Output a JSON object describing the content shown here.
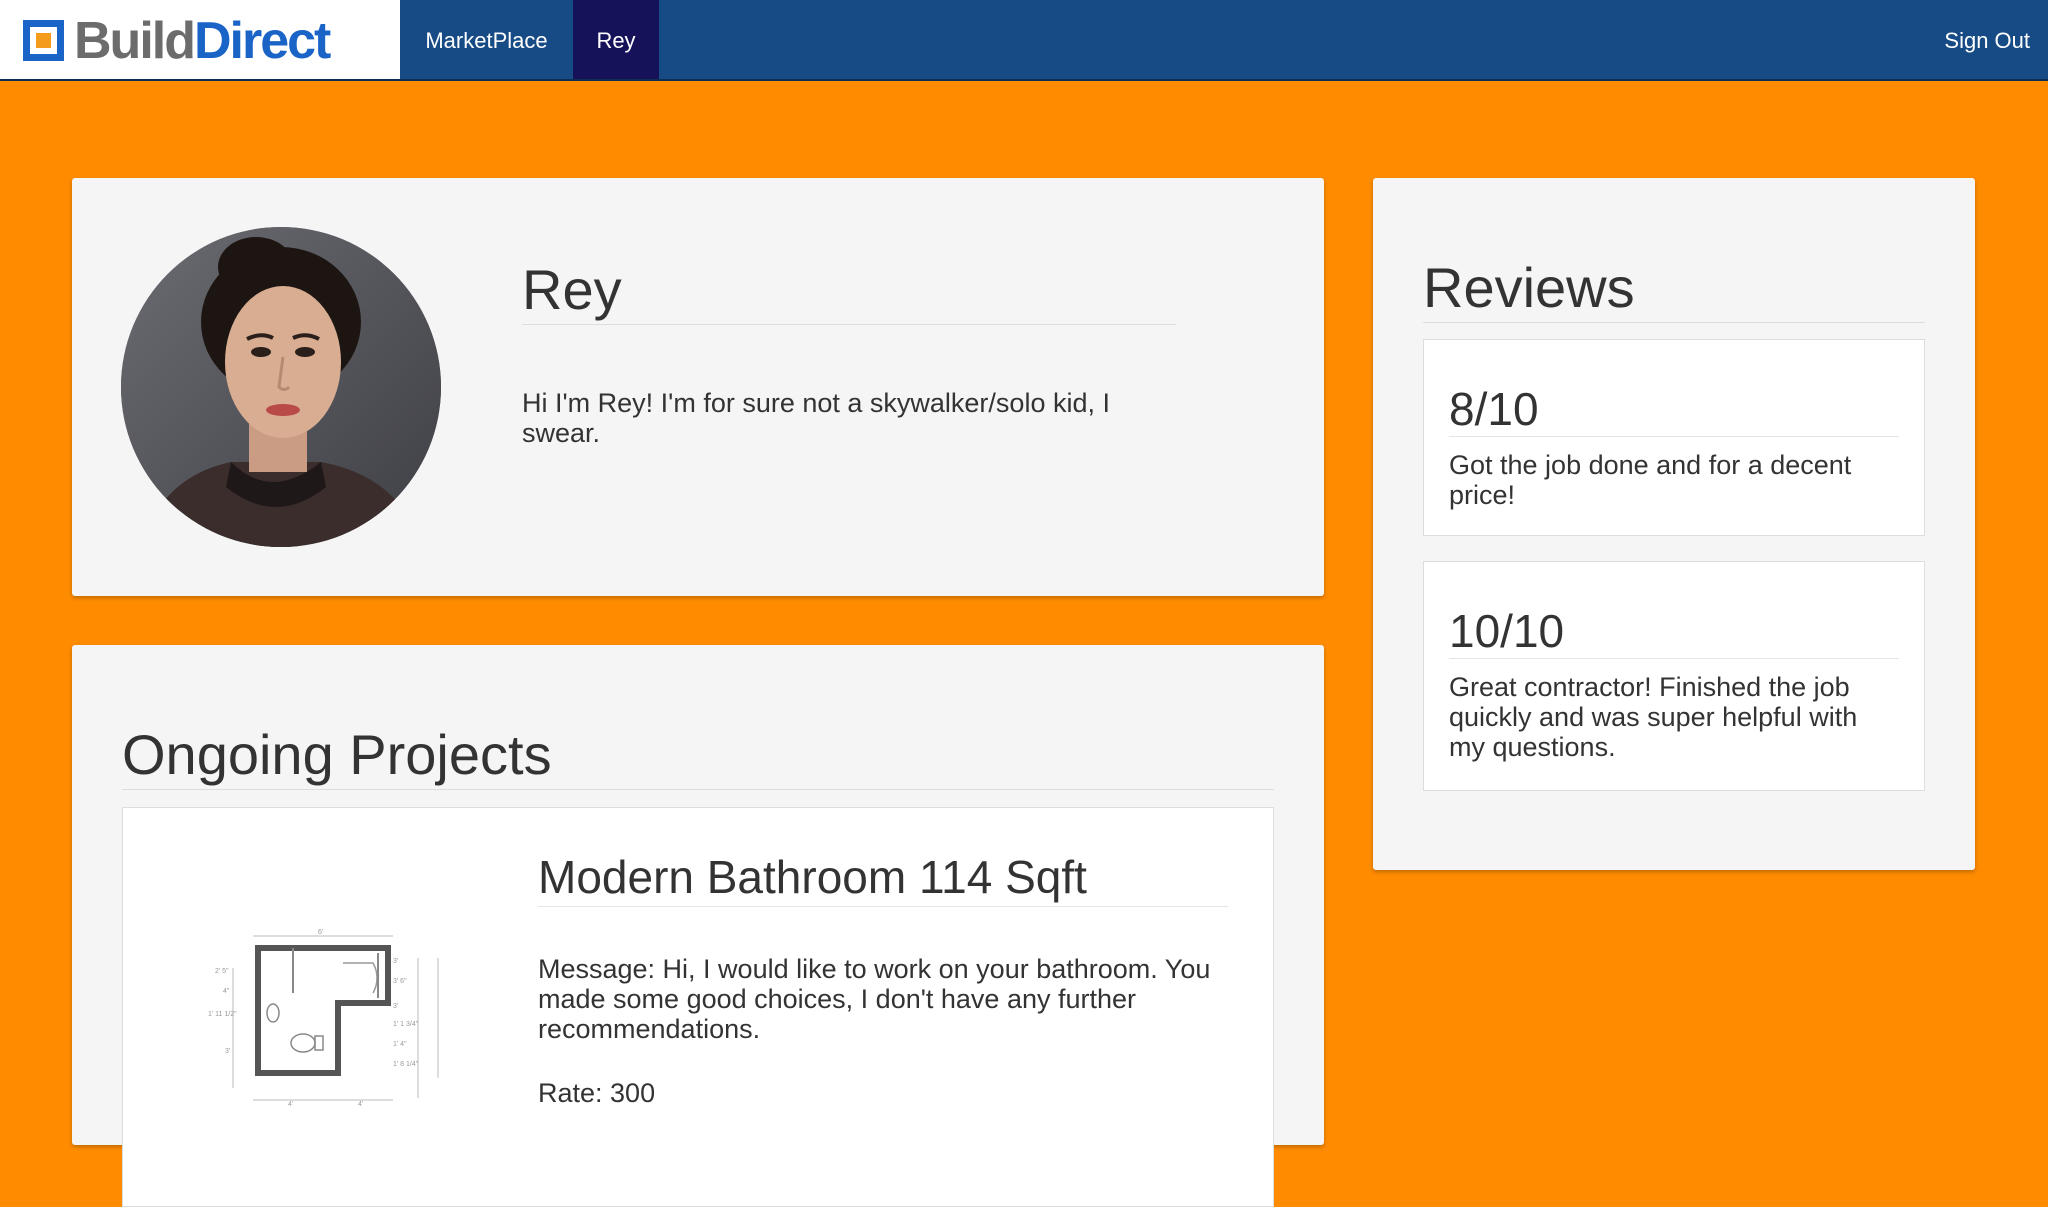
{
  "navbar": {
    "brand_part1": "Build",
    "brand_part2": "Direct",
    "items": [
      {
        "label": "MarketPlace"
      },
      {
        "label": "Rey"
      }
    ],
    "sign_out": "Sign Out",
    "colors": {
      "bar": "#174b85",
      "active": "#16125a",
      "logo_blue": "#1a63c7",
      "logo_orange": "#f59b1c"
    }
  },
  "page": {
    "background": "#ff8c00"
  },
  "profile": {
    "name": "Rey",
    "bio": "Hi I'm Rey! I'm for sure not a skywalker/solo kid, I swear."
  },
  "projects": {
    "title": "Ongoing Projects",
    "items": [
      {
        "title": "Modern Bathroom 114 Sqft",
        "message": "Message: Hi, I would like to work on your bathroom. You made some good choices, I don't have any further recommendations.",
        "rate": "Rate: 300",
        "image": "bathroom-floorplan-icon"
      }
    ]
  },
  "reviews": {
    "title": "Reviews",
    "items": [
      {
        "score": "8/10",
        "text": "Got the job done and for a decent price!"
      },
      {
        "score": "10/10",
        "text": "Great contractor! Finished the job quickly and was super helpful with my questions."
      }
    ]
  }
}
